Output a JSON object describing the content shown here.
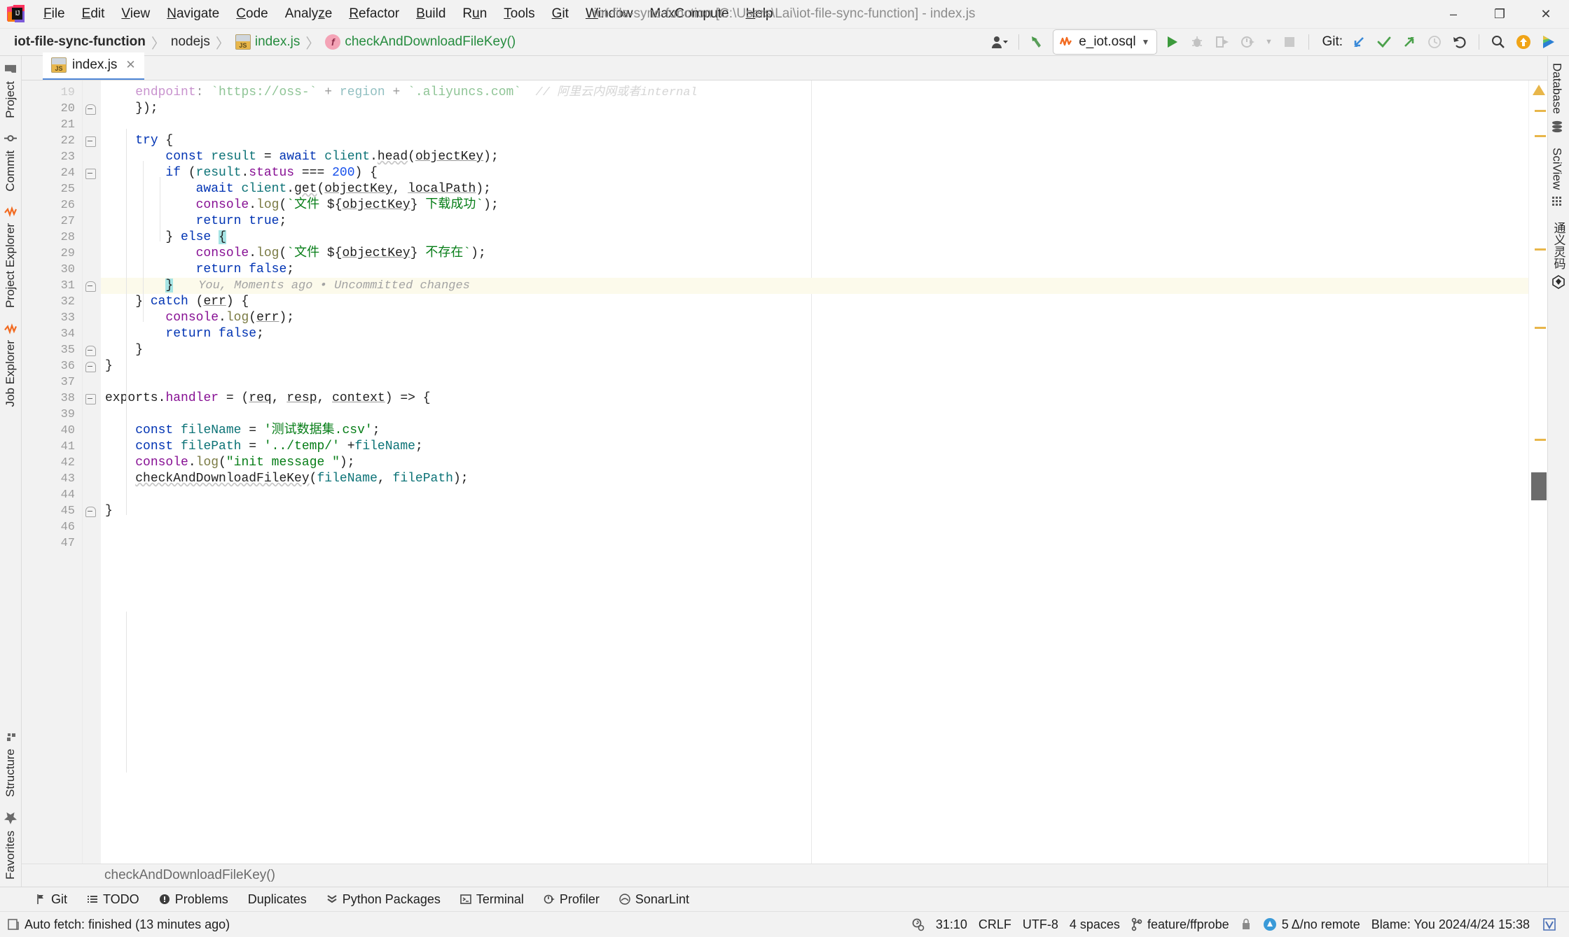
{
  "window": {
    "title": "iot-file-sync-function [C:\\Users\\Lai\\iot-file-sync-function] - index.js",
    "minimize": "–",
    "maximize": "❐",
    "close": "✕"
  },
  "menu": [
    {
      "label": "File",
      "mnemonic": "F"
    },
    {
      "label": "Edit",
      "mnemonic": "E"
    },
    {
      "label": "View",
      "mnemonic": "V"
    },
    {
      "label": "Navigate",
      "mnemonic": "N"
    },
    {
      "label": "Code",
      "mnemonic": "C"
    },
    {
      "label": "Analyze",
      "mnemonic": "z"
    },
    {
      "label": "Refactor",
      "mnemonic": "R"
    },
    {
      "label": "Build",
      "mnemonic": "B"
    },
    {
      "label": "Run",
      "mnemonic": "u"
    },
    {
      "label": "Tools",
      "mnemonic": "T"
    },
    {
      "label": "Git",
      "mnemonic": "G"
    },
    {
      "label": "Window",
      "mnemonic": "W"
    },
    {
      "label": "MaxCompute",
      "mnemonic": ""
    },
    {
      "label": "Help",
      "mnemonic": "H"
    }
  ],
  "breadcrumbs": [
    {
      "label": "iot-file-sync-function",
      "icon": "",
      "style": "bold"
    },
    {
      "label": "nodejs",
      "icon": "",
      "style": "plain"
    },
    {
      "label": "index.js",
      "icon": "js-file-icon",
      "style": "green"
    },
    {
      "label": "checkAndDownloadFileKey()",
      "icon": "function-icon",
      "style": "green"
    }
  ],
  "breadcrumb_separator": "〉",
  "toolbar": {
    "user_icon": "user-account-icon",
    "back_icon": "back-arrow-icon",
    "run_config": {
      "label": "e_iot.osql",
      "icon": "osql-config-icon",
      "chevron": "▼"
    },
    "run_icon": "run-icon",
    "debug_icon": "debug-icon",
    "run_coverage_icon": "run-with-coverage-icon",
    "profile_icon": "profile-icon",
    "profile_chevron": "▼",
    "stop_icon": "stop-icon",
    "git_label": "Git:",
    "git_update_icon": "git-update-project-icon",
    "git_commit_icon": "git-commit-icon",
    "git_push_icon": "git-push-icon",
    "git_history_icon": "git-history-icon",
    "git_rollback_icon": "git-rollback-icon",
    "search_icon": "search-everywhere-icon",
    "upload_icon": "upload-icon",
    "ai_icon": "ai-assistant-icon"
  },
  "left_stripe": [
    {
      "label": "Project",
      "icon": "project-folder-icon"
    },
    {
      "label": "Commit",
      "icon": "commit-icon"
    },
    {
      "label": "Project Explorer",
      "icon": "project-explorer-icon"
    },
    {
      "label": "Job Explorer",
      "icon": "job-explorer-icon"
    }
  ],
  "left_stripe_bottom": [
    {
      "label": "Structure",
      "icon": "structure-icon"
    },
    {
      "label": "Favorites",
      "icon": "favorites-star-icon"
    }
  ],
  "right_stripe": [
    {
      "label": "Database",
      "icon": "database-icon"
    },
    {
      "label": "SciView",
      "icon": "sciview-grid-icon"
    },
    {
      "label": "通义灵码",
      "icon": "tongyi-lingma-icon"
    }
  ],
  "editor": {
    "tab": {
      "label": "index.js",
      "icon": "js-file-icon",
      "close": "✕"
    },
    "bottom_breadcrumb": "checkAndDownloadFileKey()",
    "first_visible_line": 19,
    "lines": [
      {
        "num": "19",
        "partial": true,
        "fold": "",
        "tokens": [
          {
            "t": "    ",
            "c": "plain"
          },
          {
            "t": "endpoint",
            "c": "prop"
          },
          {
            "t": ": ",
            "c": "plain"
          },
          {
            "t": "`https://oss-`",
            "c": "str"
          },
          {
            "t": " + ",
            "c": "plain"
          },
          {
            "t": "region",
            "c": "loc"
          },
          {
            "t": " + ",
            "c": "plain"
          },
          {
            "t": "`.aliyuncs.com`",
            "c": "str"
          },
          {
            "t": "  // 阿里云内网或者internal",
            "c": "blame"
          }
        ]
      },
      {
        "num": "20",
        "fold": "end",
        "tokens": [
          {
            "t": "    });",
            "c": "plain"
          }
        ]
      },
      {
        "num": "21",
        "fold": "",
        "tokens": []
      },
      {
        "num": "22",
        "fold": "start",
        "tokens": [
          {
            "t": "    ",
            "c": "plain"
          },
          {
            "t": "try",
            "c": "kw"
          },
          {
            "t": " {",
            "c": "plain"
          }
        ]
      },
      {
        "num": "23",
        "fold": "",
        "tokens": [
          {
            "t": "        ",
            "c": "plain"
          },
          {
            "t": "const",
            "c": "kw"
          },
          {
            "t": " ",
            "c": "plain"
          },
          {
            "t": "result",
            "c": "loc"
          },
          {
            "t": " = ",
            "c": "plain"
          },
          {
            "t": "await",
            "c": "kw"
          },
          {
            "t": " ",
            "c": "plain"
          },
          {
            "t": "client",
            "c": "loc"
          },
          {
            "t": ".",
            "c": "plain"
          },
          {
            "t": "head",
            "c": "err"
          },
          {
            "t": "(",
            "c": "plain"
          },
          {
            "t": "objectKey",
            "c": "param"
          },
          {
            "t": ");",
            "c": "plain"
          }
        ]
      },
      {
        "num": "24",
        "fold": "start",
        "tokens": [
          {
            "t": "        ",
            "c": "plain"
          },
          {
            "t": "if",
            "c": "kw"
          },
          {
            "t": " (",
            "c": "plain"
          },
          {
            "t": "result",
            "c": "loc"
          },
          {
            "t": ".",
            "c": "plain"
          },
          {
            "t": "status",
            "c": "prop"
          },
          {
            "t": " === ",
            "c": "plain"
          },
          {
            "t": "200",
            "c": "num"
          },
          {
            "t": ") {",
            "c": "plain"
          }
        ]
      },
      {
        "num": "25",
        "fold": "",
        "tokens": [
          {
            "t": "            ",
            "c": "plain"
          },
          {
            "t": "await",
            "c": "kw"
          },
          {
            "t": " ",
            "c": "plain"
          },
          {
            "t": "client",
            "c": "loc"
          },
          {
            "t": ".",
            "c": "plain"
          },
          {
            "t": "get",
            "c": "err"
          },
          {
            "t": "(",
            "c": "plain"
          },
          {
            "t": "objectKey",
            "c": "param"
          },
          {
            "t": ", ",
            "c": "plain"
          },
          {
            "t": "localPath",
            "c": "param"
          },
          {
            "t": ");",
            "c": "plain"
          }
        ]
      },
      {
        "num": "26",
        "fold": "",
        "tokens": [
          {
            "t": "            ",
            "c": "plain"
          },
          {
            "t": "console",
            "c": "prop"
          },
          {
            "t": ".",
            "c": "plain"
          },
          {
            "t": "log",
            "c": "fnc"
          },
          {
            "t": "(",
            "c": "plain"
          },
          {
            "t": "`文件 ",
            "c": "str"
          },
          {
            "t": "${",
            "c": "plain"
          },
          {
            "t": "objectKey",
            "c": "param"
          },
          {
            "t": "}",
            "c": "plain"
          },
          {
            "t": " 下载成功`",
            "c": "str"
          },
          {
            "t": ");",
            "c": "plain"
          }
        ]
      },
      {
        "num": "27",
        "fold": "",
        "tokens": [
          {
            "t": "            ",
            "c": "plain"
          },
          {
            "t": "return",
            "c": "kw"
          },
          {
            "t": " ",
            "c": "plain"
          },
          {
            "t": "true",
            "c": "kw"
          },
          {
            "t": ";",
            "c": "plain"
          }
        ]
      },
      {
        "num": "28",
        "fold": "",
        "tokens": [
          {
            "t": "        } ",
            "c": "plain"
          },
          {
            "t": "else",
            "c": "kw"
          },
          {
            "t": " ",
            "c": "plain"
          },
          {
            "t": "{",
            "c": "sel"
          }
        ]
      },
      {
        "num": "29",
        "fold": "",
        "tokens": [
          {
            "t": "            ",
            "c": "plain"
          },
          {
            "t": "console",
            "c": "prop"
          },
          {
            "t": ".",
            "c": "plain"
          },
          {
            "t": "log",
            "c": "fnc"
          },
          {
            "t": "(",
            "c": "plain"
          },
          {
            "t": "`文件 ",
            "c": "str"
          },
          {
            "t": "${",
            "c": "plain"
          },
          {
            "t": "objectKey",
            "c": "param"
          },
          {
            "t": "}",
            "c": "plain"
          },
          {
            "t": " 不存在`",
            "c": "str"
          },
          {
            "t": ");",
            "c": "plain"
          }
        ]
      },
      {
        "num": "30",
        "fold": "",
        "tokens": [
          {
            "t": "            ",
            "c": "plain"
          },
          {
            "t": "return",
            "c": "kw"
          },
          {
            "t": " ",
            "c": "plain"
          },
          {
            "t": "false",
            "c": "kw"
          },
          {
            "t": ";",
            "c": "plain"
          }
        ]
      },
      {
        "num": "31",
        "fold": "arrow",
        "highlight": true,
        "blame": "You, Moments ago • Uncommitted changes",
        "tokens": [
          {
            "t": "        ",
            "c": "plain"
          },
          {
            "t": "}",
            "c": "sel"
          }
        ]
      },
      {
        "num": "32",
        "fold": "",
        "tokens": [
          {
            "t": "    } ",
            "c": "plain"
          },
          {
            "t": "catch",
            "c": "kw"
          },
          {
            "t": " (",
            "c": "plain"
          },
          {
            "t": "err",
            "c": "param"
          },
          {
            "t": ") {",
            "c": "plain"
          }
        ]
      },
      {
        "num": "33",
        "fold": "",
        "tokens": [
          {
            "t": "        ",
            "c": "plain"
          },
          {
            "t": "console",
            "c": "prop"
          },
          {
            "t": ".",
            "c": "plain"
          },
          {
            "t": "log",
            "c": "fnc"
          },
          {
            "t": "(",
            "c": "plain"
          },
          {
            "t": "err",
            "c": "param"
          },
          {
            "t": ");",
            "c": "plain"
          }
        ]
      },
      {
        "num": "34",
        "fold": "",
        "tokens": [
          {
            "t": "        ",
            "c": "plain"
          },
          {
            "t": "return",
            "c": "kw"
          },
          {
            "t": " ",
            "c": "plain"
          },
          {
            "t": "false",
            "c": "kw"
          },
          {
            "t": ";",
            "c": "plain"
          }
        ]
      },
      {
        "num": "35",
        "fold": "end",
        "tokens": [
          {
            "t": "    }",
            "c": "plain"
          }
        ]
      },
      {
        "num": "36",
        "fold": "endtop",
        "tokens": [
          {
            "t": "}",
            "c": "plain"
          }
        ]
      },
      {
        "num": "37",
        "fold": "",
        "tokens": []
      },
      {
        "num": "38",
        "fold": "start2",
        "tokens": [
          {
            "t": "exports",
            "c": "plain"
          },
          {
            "t": ".",
            "c": "plain"
          },
          {
            "t": "handler",
            "c": "prop"
          },
          {
            "t": " = (",
            "c": "plain"
          },
          {
            "t": "req",
            "c": "param"
          },
          {
            "t": ", ",
            "c": "plain"
          },
          {
            "t": "resp",
            "c": "param"
          },
          {
            "t": ", ",
            "c": "plain"
          },
          {
            "t": "context",
            "c": "param"
          },
          {
            "t": ") => {",
            "c": "plain"
          }
        ]
      },
      {
        "num": "39",
        "fold": "",
        "tokens": []
      },
      {
        "num": "40",
        "fold": "",
        "tokens": [
          {
            "t": "    ",
            "c": "plain"
          },
          {
            "t": "const",
            "c": "kw"
          },
          {
            "t": " ",
            "c": "plain"
          },
          {
            "t": "fileName",
            "c": "loc"
          },
          {
            "t": " = ",
            "c": "plain"
          },
          {
            "t": "'测试数据集.csv'",
            "c": "str"
          },
          {
            "t": ";",
            "c": "plain"
          }
        ]
      },
      {
        "num": "41",
        "fold": "",
        "tokens": [
          {
            "t": "    ",
            "c": "plain"
          },
          {
            "t": "const",
            "c": "kw"
          },
          {
            "t": " ",
            "c": "plain"
          },
          {
            "t": "filePath",
            "c": "loc"
          },
          {
            "t": " = ",
            "c": "plain"
          },
          {
            "t": "'../temp/'",
            "c": "str"
          },
          {
            "t": " +",
            "c": "plain"
          },
          {
            "t": "fileName",
            "c": "loc"
          },
          {
            "t": ";",
            "c": "plain"
          }
        ]
      },
      {
        "num": "42",
        "fold": "",
        "tokens": [
          {
            "t": "    ",
            "c": "plain"
          },
          {
            "t": "console",
            "c": "prop"
          },
          {
            "t": ".",
            "c": "plain"
          },
          {
            "t": "log",
            "c": "fnc"
          },
          {
            "t": "(",
            "c": "plain"
          },
          {
            "t": "\"init message \"",
            "c": "str"
          },
          {
            "t": ");",
            "c": "plain"
          }
        ]
      },
      {
        "num": "43",
        "fold": "",
        "tokens": [
          {
            "t": "    ",
            "c": "plain"
          },
          {
            "t": "checkAndDownloadFileKey",
            "c": "err"
          },
          {
            "t": "(",
            "c": "plain"
          },
          {
            "t": "fileName",
            "c": "loc"
          },
          {
            "t": ", ",
            "c": "plain"
          },
          {
            "t": "filePath",
            "c": "loc"
          },
          {
            "t": ");",
            "c": "plain"
          }
        ]
      },
      {
        "num": "44",
        "fold": "",
        "tokens": []
      },
      {
        "num": "45",
        "fold": "endtop",
        "tokens": [
          {
            "t": "}",
            "c": "plain"
          }
        ]
      },
      {
        "num": "46",
        "fold": "",
        "tokens": []
      },
      {
        "num": "47",
        "fold": "",
        "tokens": []
      }
    ]
  },
  "tool_windows": [
    {
      "label": "Git",
      "icon": "git-branch-icon"
    },
    {
      "label": "TODO",
      "icon": "todo-list-icon"
    },
    {
      "label": "Problems",
      "icon": "problems-icon"
    },
    {
      "label": "Duplicates",
      "icon": ""
    },
    {
      "label": "Python Packages",
      "icon": "python-packages-icon"
    },
    {
      "label": "Terminal",
      "icon": "terminal-icon"
    },
    {
      "label": "Profiler",
      "icon": "profiler-icon"
    },
    {
      "label": "SonarLint",
      "icon": "sonarlint-icon"
    }
  ],
  "status_bar": {
    "message": "Auto fetch: finished (13 minutes ago)",
    "message_icon": "notification-icon",
    "right": {
      "inspection_icon": "inspections-icon",
      "caret_position": "31:10",
      "line_separator": "CRLF",
      "encoding": "UTF-8",
      "indent": "4 spaces",
      "branch_icon": "git-branch-icon",
      "branch": "feature/ffprobe",
      "lock_icon": "read-only-lock-icon",
      "changes_icon": "changes-icon",
      "changes": "5 Δ/no remote",
      "blame": "Blame: You 2024/4/24 15:38",
      "ide_icon": "ide-status-icon"
    }
  },
  "colors": {
    "accent_blue": "#4f87d8",
    "keyword": "#0033b3",
    "string": "#067d17",
    "number": "#1750eb",
    "property": "#871094",
    "function": "#7a7a43",
    "local": "#0d7377",
    "highlight_line": "#fcfaeb",
    "selection": "#a6e4e4",
    "warning_stripe": "#e8b64a"
  }
}
